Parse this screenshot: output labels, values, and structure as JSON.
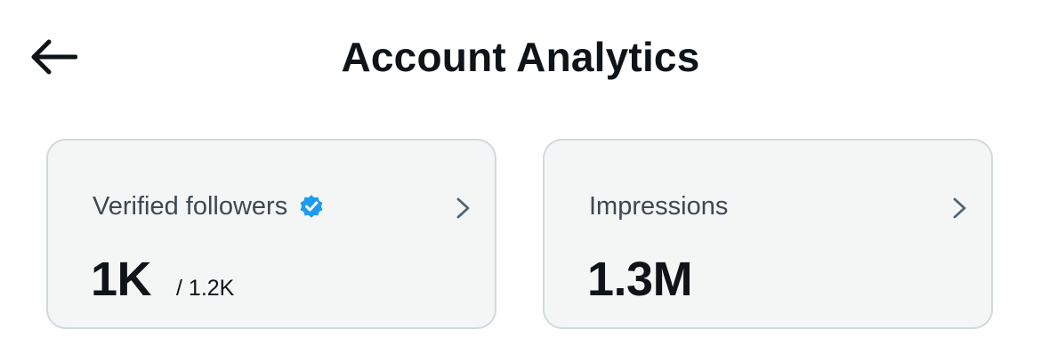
{
  "header": {
    "title": "Account Analytics",
    "back_icon": "arrow-left-icon"
  },
  "cards": [
    {
      "label": "Verified followers",
      "badge_icon": "verified-badge-icon",
      "badge_color": "#1d9bf0",
      "value": "1K",
      "subvalue": "/ 1.2K",
      "chevron_icon": "chevron-right-icon"
    },
    {
      "label": "Impressions",
      "value": "1.3M",
      "chevron_icon": "chevron-right-icon"
    }
  ],
  "colors": {
    "card_background": "#f4f6f6",
    "card_border": "#cfd9de",
    "text_primary": "#0f1419",
    "text_secondary": "#3d4852",
    "accent": "#1d9bf0"
  }
}
